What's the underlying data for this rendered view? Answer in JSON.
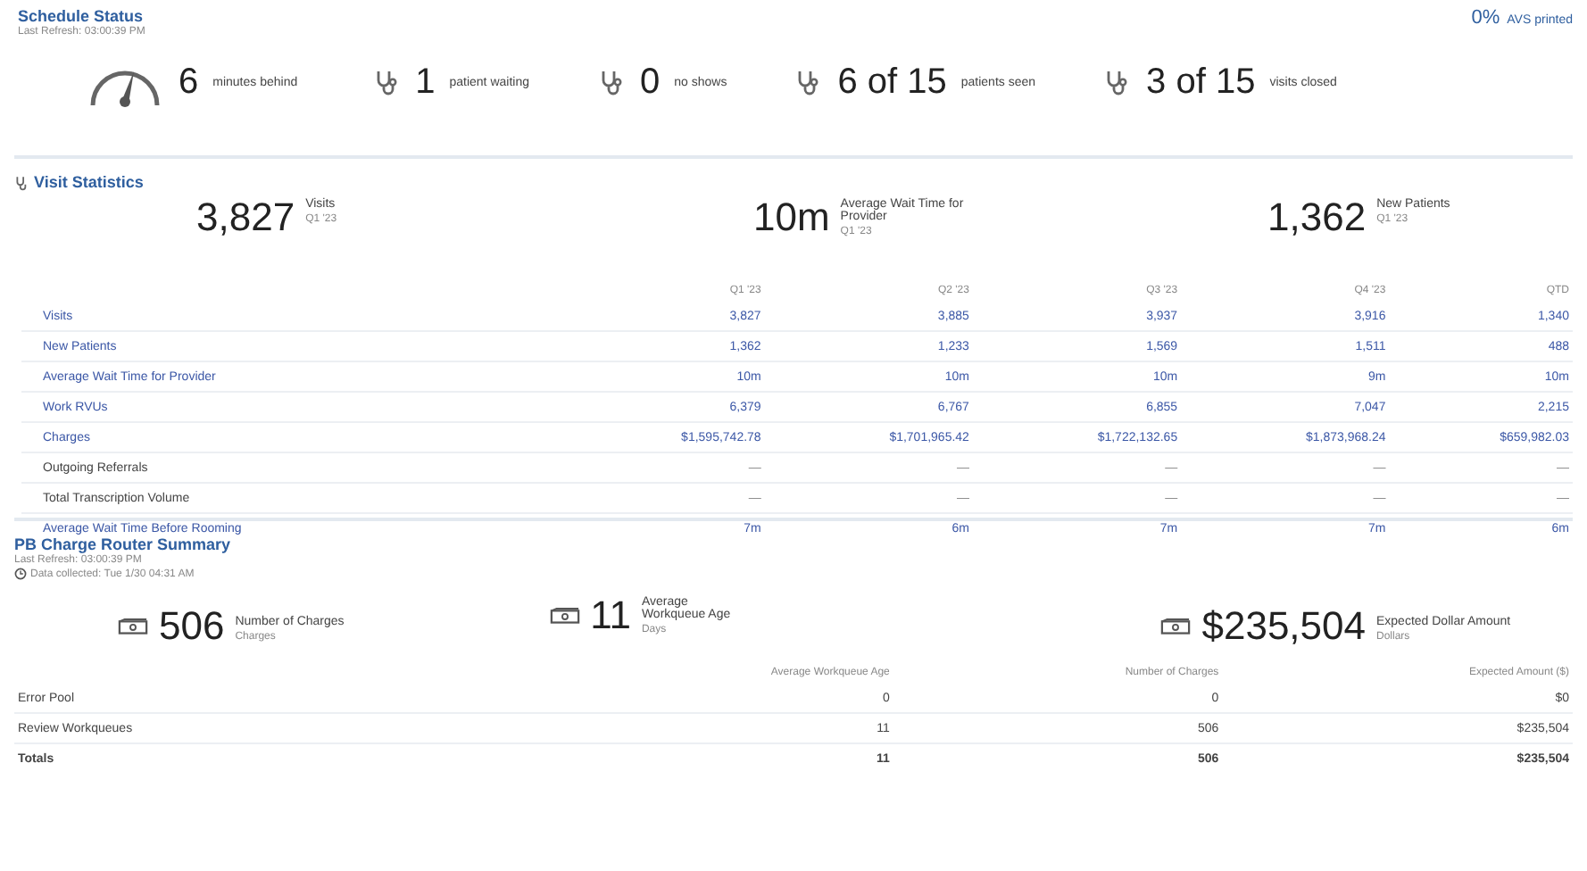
{
  "schedule_status": {
    "title": "Schedule Status",
    "last_refresh": "Last Refresh: 03:00:39 PM",
    "avs": {
      "value": "0%",
      "label": "AVS printed"
    },
    "metrics": [
      {
        "kind": "gauge",
        "value": "6",
        "label": "minutes behind"
      },
      {
        "kind": "stethoscope",
        "value": "1",
        "label": "patient waiting"
      },
      {
        "kind": "stethoscope",
        "value": "0",
        "label": "no shows"
      },
      {
        "kind": "stethoscope",
        "value": "6 of 15",
        "label": "patients seen"
      },
      {
        "kind": "stethoscope",
        "value": "3 of 15",
        "label": "visits closed"
      }
    ]
  },
  "visit_statistics": {
    "title": "Visit Statistics",
    "summary": [
      {
        "value": "3,827",
        "label": "Visits",
        "period": "Q1 '23"
      },
      {
        "value": "10m",
        "label": "Average Wait Time for Provider",
        "period": "Q1 '23"
      },
      {
        "value": "1,362",
        "label": "New Patients",
        "period": "Q1 '23"
      }
    ],
    "table": {
      "columns": [
        "Q1 '23",
        "Q2 '23",
        "Q3 '23",
        "Q4 '23",
        "QTD"
      ],
      "rows": [
        {
          "kind": "link",
          "label": "Visits",
          "values": [
            "3,827",
            "3,885",
            "3,937",
            "3,916",
            "1,340"
          ]
        },
        {
          "kind": "link",
          "label": "New Patients",
          "values": [
            "1,362",
            "1,233",
            "1,569",
            "1,511",
            "488"
          ]
        },
        {
          "kind": "link",
          "label": "Average Wait Time for Provider",
          "values": [
            "10m",
            "10m",
            "10m",
            "9m",
            "10m"
          ]
        },
        {
          "kind": "link",
          "label": "Work RVUs",
          "values": [
            "6,379",
            "6,767",
            "6,855",
            "7,047",
            "2,215"
          ]
        },
        {
          "kind": "link",
          "label": "Charges",
          "values": [
            "$1,595,742.78",
            "$1,701,965.42",
            "$1,722,132.65",
            "$1,873,968.24",
            "$659,982.03"
          ]
        },
        {
          "kind": "plain",
          "label": "Outgoing Referrals",
          "values": [
            "—",
            "—",
            "—",
            "—",
            "—"
          ]
        },
        {
          "kind": "plain",
          "label": "Total Transcription Volume",
          "values": [
            "—",
            "—",
            "—",
            "—",
            "—"
          ]
        },
        {
          "kind": "link",
          "label": "Average Wait Time Before Rooming",
          "values": [
            "7m",
            "6m",
            "7m",
            "7m",
            "6m"
          ]
        }
      ]
    }
  },
  "charge_router": {
    "title": "PB Charge Router Summary",
    "last_refresh": "Last Refresh: 03:00:39 PM",
    "data_collected": "Data collected: Tue 1/30 04:31 AM",
    "summary": [
      {
        "value": "506",
        "label": "Number of Charges",
        "unit": "Charges"
      },
      {
        "value": "11",
        "label": "Average Workqueue Age",
        "unit": "Days"
      },
      {
        "value": "$235,504",
        "label": "Expected Dollar Amount",
        "unit": "Dollars"
      }
    ],
    "table": {
      "columns": [
        "Average Workqueue Age",
        "Number of Charges",
        "Expected Amount ($)"
      ],
      "rows": [
        {
          "kind": "normal",
          "label": "Error Pool",
          "values": [
            "0",
            "0",
            "$0"
          ]
        },
        {
          "kind": "normal",
          "label": "Review Workqueues",
          "values": [
            "11",
            "506",
            "$235,504"
          ]
        },
        {
          "kind": "total",
          "label": "Totals",
          "values": [
            "11",
            "506",
            "$235,504"
          ]
        }
      ]
    }
  }
}
